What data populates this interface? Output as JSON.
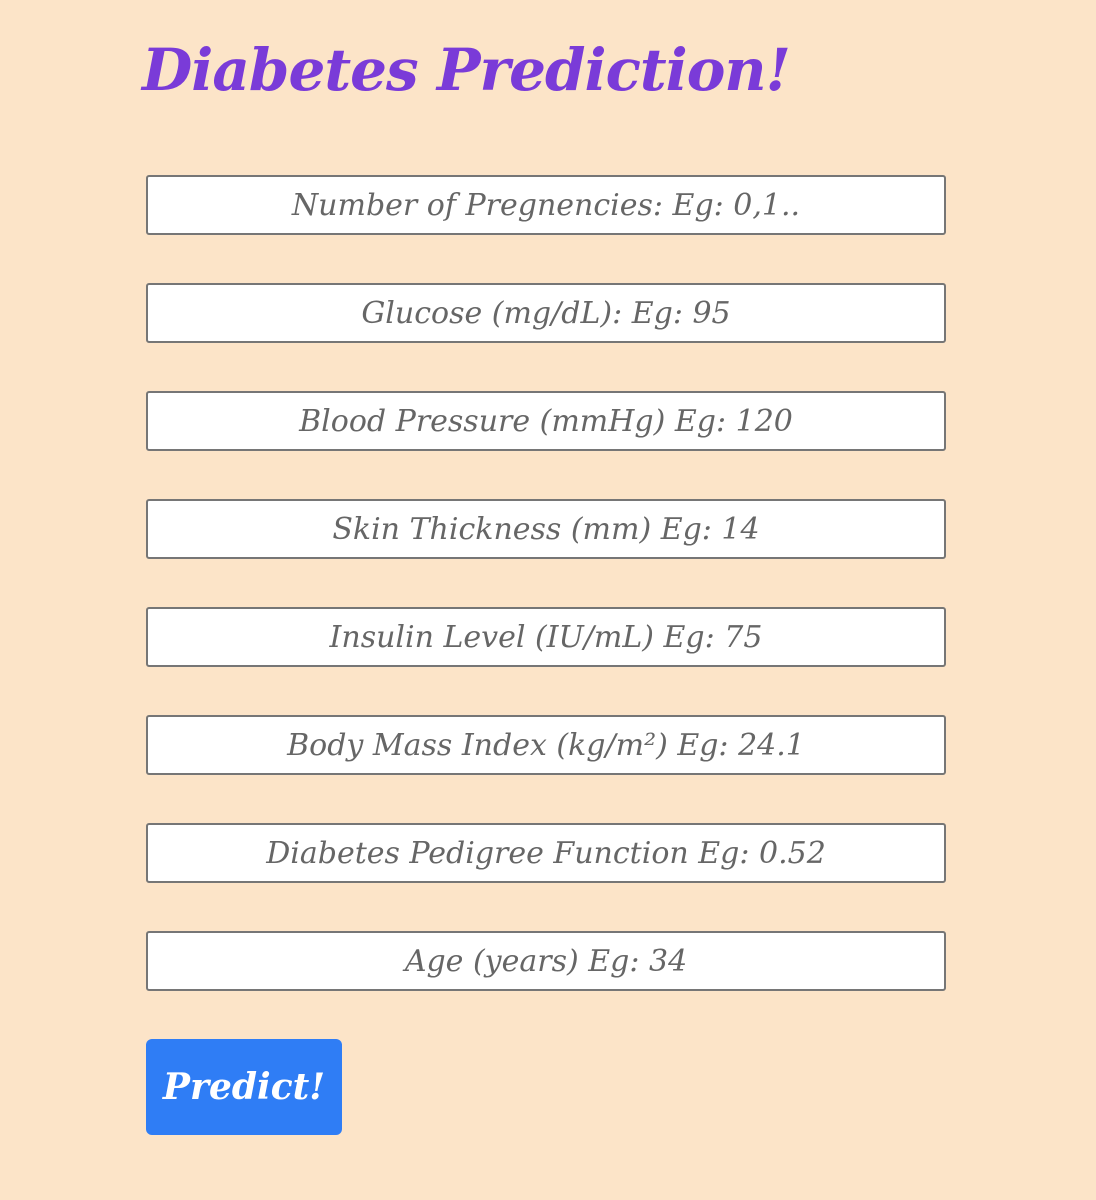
{
  "page": {
    "title": "Diabetes Prediction!"
  },
  "form": {
    "fields": [
      {
        "placeholder": "Number of Pregnencies: Eg: 0,1..",
        "value": ""
      },
      {
        "placeholder": "Glucose (mg/dL): Eg: 95",
        "value": ""
      },
      {
        "placeholder": "Blood Pressure (mmHg) Eg: 120",
        "value": ""
      },
      {
        "placeholder": "Skin Thickness (mm) Eg: 14",
        "value": ""
      },
      {
        "placeholder": "Insulin Level (IU/mL) Eg: 75",
        "value": ""
      },
      {
        "placeholder": "Body Mass Index (kg/m²) Eg: 24.1",
        "value": ""
      },
      {
        "placeholder": "Diabetes Pedigree Function Eg: 0.52",
        "value": ""
      },
      {
        "placeholder": "Age (years) Eg: 34",
        "value": ""
      }
    ],
    "submit_label": "Predict!"
  },
  "colors": {
    "background": "#fce4c8",
    "title": "#7a3bd8",
    "button": "#2f7df5",
    "button_text": "#ffffff",
    "field_border": "#767676"
  }
}
